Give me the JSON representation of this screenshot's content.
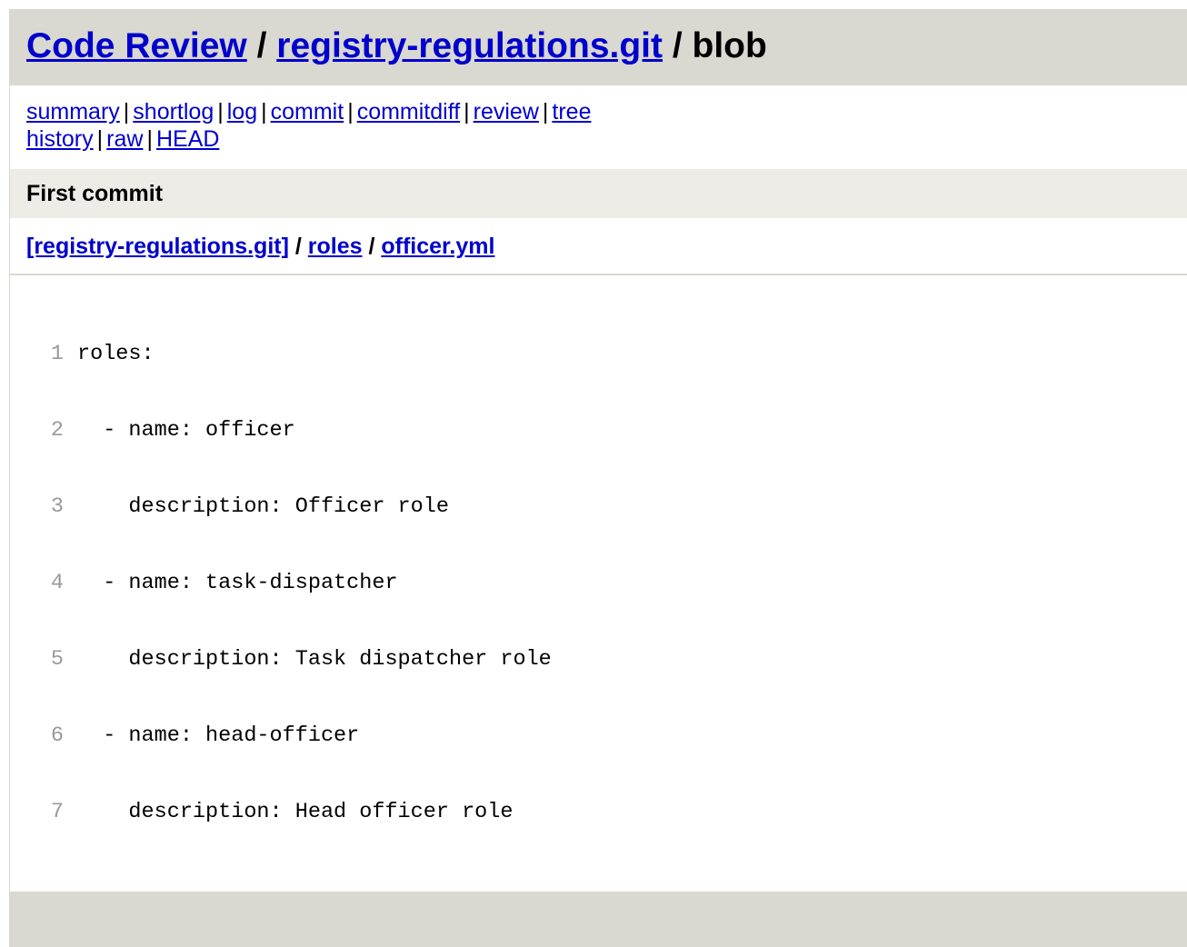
{
  "header": {
    "project_link": "Code Review",
    "sep1": " / ",
    "repo_link": "registry-regulations.git",
    "sep2": " / ",
    "action": "blob"
  },
  "nav": {
    "row1": [
      "summary",
      "shortlog",
      "log",
      "commit",
      "commitdiff",
      "review",
      "tree"
    ],
    "row2": [
      "history",
      "raw",
      "HEAD"
    ],
    "separator": "|"
  },
  "commit_title": "First commit",
  "path": {
    "root": "[registry-regulations.git]",
    "sep1": " / ",
    "dir": "roles",
    "sep2": " / ",
    "file": "officer.yml"
  },
  "blob": {
    "lines": [
      {
        "number": "1",
        "text": "roles:"
      },
      {
        "number": "2",
        "text": "  - name: officer"
      },
      {
        "number": "3",
        "text": "    description: Officer role"
      },
      {
        "number": "4",
        "text": "  - name: task-dispatcher"
      },
      {
        "number": "5",
        "text": "    description: Task dispatcher role"
      },
      {
        "number": "6",
        "text": "  - name: head-officer"
      },
      {
        "number": "7",
        "text": "    description: Head officer role"
      }
    ]
  },
  "colors": {
    "header_bg": "#d9d8d1",
    "title_bg": "#edece6",
    "link": "#0000cc",
    "line_number": "#999999"
  }
}
